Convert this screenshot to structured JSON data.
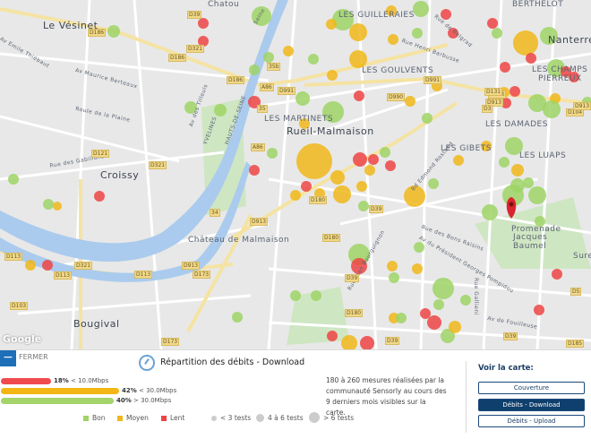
{
  "map": {
    "places": [
      "Le Vésinet",
      "Chatou",
      "LES GUILLERAIES",
      "Nanterre",
      "LES GOULVENTS",
      "LES CHAMPS",
      "PIERREUX",
      "LES MARTINETS",
      "Rueil-Malmaison",
      "LES DAMADES",
      "LES GIBETS",
      "LES LUAPS",
      "Croissy",
      "Château de Malmaison",
      "Promenade",
      "Jacques",
      "Baumel",
      "Bougival",
      "BERTHELOT",
      "Sure"
    ],
    "streets": [
      "Av Emile Thiébaut",
      "Av Maurice Berteaux",
      "Roule de la Plaine",
      "Rue des Gabillons",
      "Av des Tilleuls",
      "YVELINES",
      "HAUTS-DE-SEINE",
      "Seine",
      "Rue Henri Barbusse",
      "Rue de Belgrad",
      "Rue des Bons Raisins",
      "Av du Président Georges Pompidou",
      "Rue Jean Bourguignon",
      "Av de Fouilleuse",
      "Rue Gallieni",
      "Bd Edmond Rostand"
    ],
    "roads": [
      "D186",
      "D321",
      "D39",
      "D186",
      "D186",
      "A86",
      "D991",
      "35b",
      "35",
      "A86",
      "D121",
      "D321",
      "D113",
      "D113",
      "D321",
      "D103",
      "D113",
      "D913",
      "D173",
      "D173",
      "34",
      "D913",
      "D991",
      "D990",
      "D913",
      "D131",
      "D913",
      "D3",
      "D180",
      "D180",
      "D180",
      "D39",
      "D39",
      "D39",
      "D39",
      "D5",
      "D104",
      "D913",
      "D185"
    ],
    "attribution": "Google"
  },
  "panel": {
    "close_label": "FERMER",
    "title": "Répartition des débits - Download",
    "bars": [
      {
        "pct": 18,
        "pct_label": "18%",
        "range": "< 10.0Mbps",
        "color": "#f04a4f"
      },
      {
        "pct": 42,
        "pct_label": "42%",
        "range": "< 30.0Mbps",
        "color": "#f3b614"
      },
      {
        "pct": 40,
        "pct_label": "40%",
        "range": "> 30.0Mbps",
        "color": "#a4d46a"
      }
    ],
    "legend": {
      "good": "Bon",
      "medium": "Moyen",
      "slow": "Lent",
      "small": "< 3 tests",
      "mid": "4 à 6 tests",
      "large": "> 6 tests"
    },
    "colors": {
      "good": "#9ed365",
      "medium": "#f0b71a",
      "slow": "#ee4444"
    },
    "description": "180 à 260 mesures réalisées par la communauté Sensorly au cours des 9 derniers mois visibles sur la carte.",
    "voir_title": "Voir la carte:",
    "buttons": [
      "Couverture",
      "Débits - Download",
      "Débits - Upload"
    ]
  }
}
